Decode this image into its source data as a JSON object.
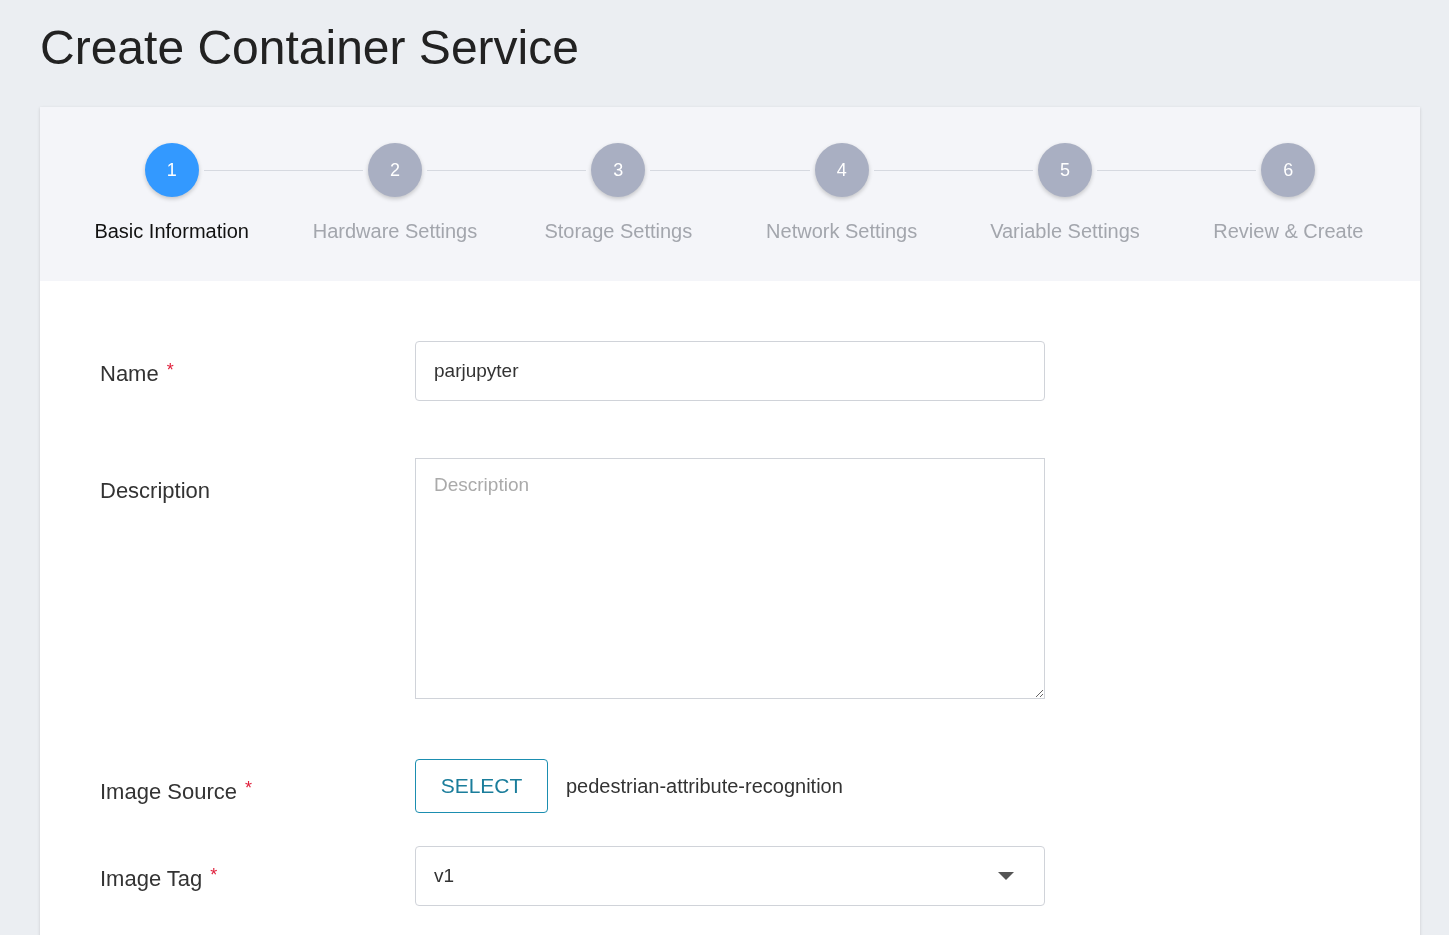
{
  "title": "Create Container Service",
  "steps": [
    {
      "number": "1",
      "label": "Basic Information",
      "selected": true
    },
    {
      "number": "2",
      "label": "Hardware Settings",
      "selected": false
    },
    {
      "number": "3",
      "label": "Storage Settings",
      "selected": false
    },
    {
      "number": "4",
      "label": "Network Settings",
      "selected": false
    },
    {
      "number": "5",
      "label": "Variable Settings",
      "selected": false
    },
    {
      "number": "6",
      "label": "Review & Create",
      "selected": false
    }
  ],
  "fields": [
    {
      "kind": "text",
      "label": "Name",
      "required_mark": "*",
      "value": "parjupyter"
    },
    {
      "kind": "textarea",
      "label": "Description",
      "placeholder": "Description"
    },
    {
      "kind": "source",
      "label": "Image Source",
      "required_mark": "*",
      "button": "SELECT",
      "value": "pedestrian-attribute-recognition"
    },
    {
      "kind": "select",
      "label": "Image Tag",
      "required_mark": "*",
      "value": "v1"
    }
  ]
}
